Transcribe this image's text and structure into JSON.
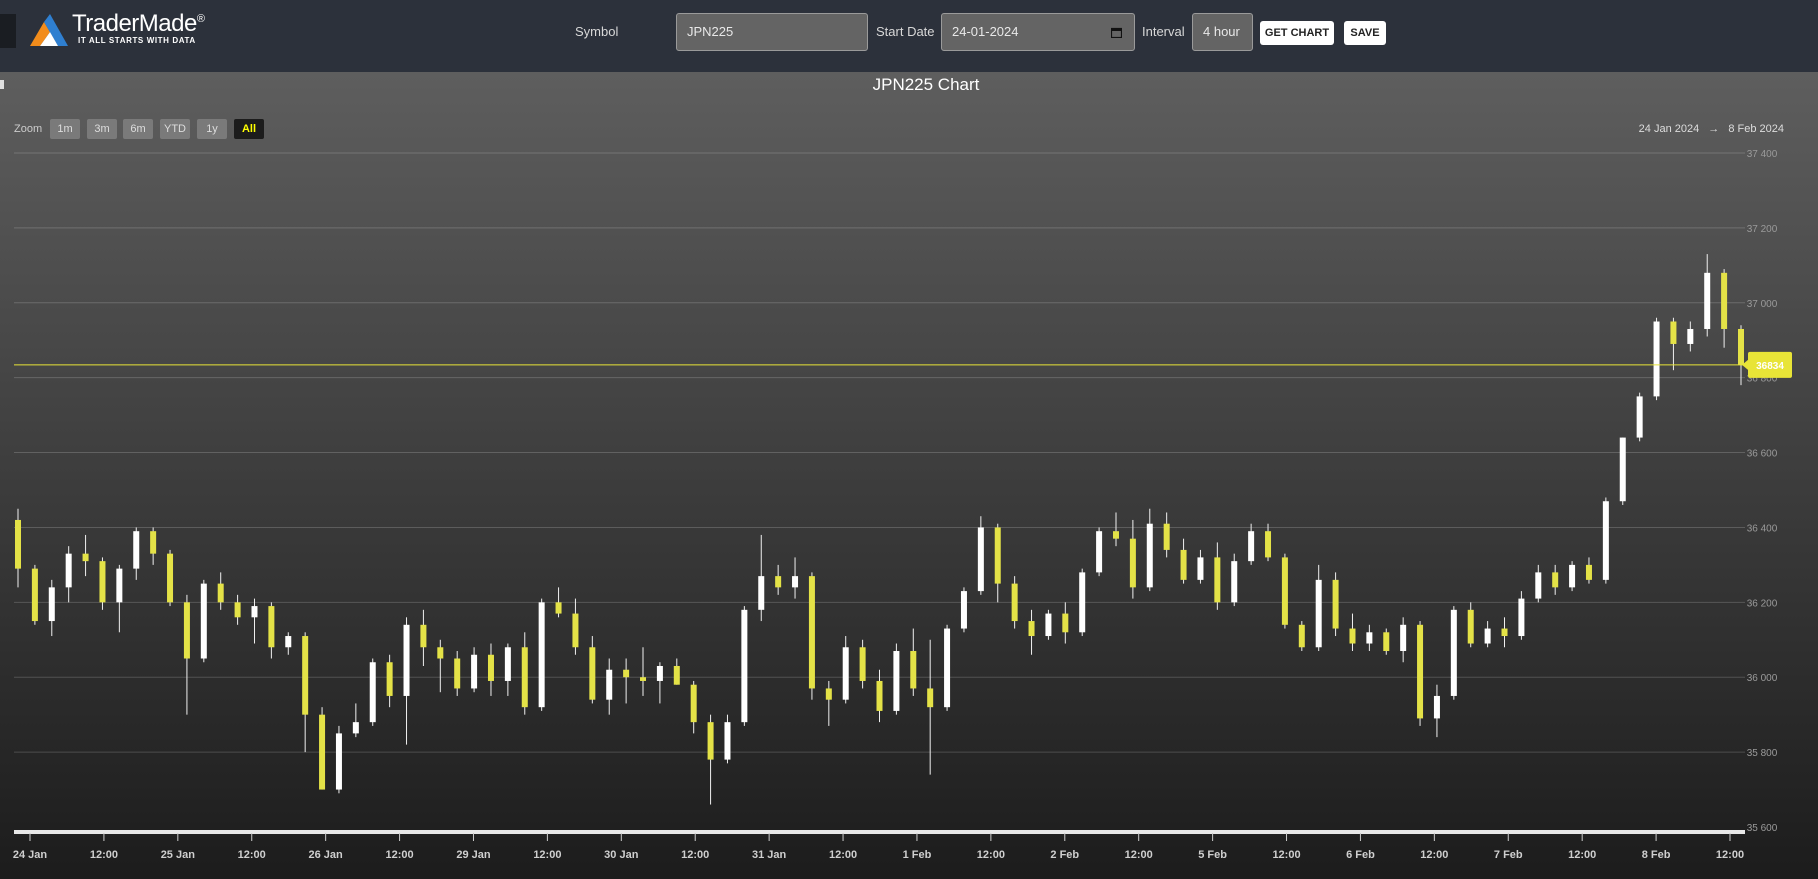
{
  "header": {
    "logo_name": "TraderMade",
    "logo_tagline": "IT ALL STARTS WITH DATA",
    "symbol_label": "Symbol",
    "symbol_value": "JPN225",
    "start_date_label": "Start Date",
    "start_date_value": "24-01-2024",
    "interval_label": "Interval",
    "interval_value": "4 hour",
    "get_chart_label": "GET CHART",
    "save_label": "SAVE"
  },
  "zoom": {
    "label": "Zoom",
    "buttons": [
      "1m",
      "3m",
      "6m",
      "YTD",
      "1y",
      "All"
    ],
    "active": "All"
  },
  "range": {
    "from": "24 Jan 2024",
    "arrow": "→",
    "to": "8 Feb 2024"
  },
  "colors": {
    "up": "#ffffff",
    "down": "#e4e247",
    "last_price": "#e8e437",
    "background_top": "#5e5e5e",
    "background_bottom": "#1c1c1c"
  },
  "chart_data": {
    "type": "candlestick",
    "title": "JPN225 Chart",
    "ylim": [
      35600,
      37400
    ],
    "y_ticks": [
      "35 600",
      "35 800",
      "36 000",
      "36 200",
      "36 400",
      "36 600",
      "36 800",
      "37 000",
      "37 200",
      "37 400"
    ],
    "x_tick_labels": [
      "24 Jan",
      "12:00",
      "25 Jan",
      "12:00",
      "26 Jan",
      "12:00",
      "29 Jan",
      "12:00",
      "30 Jan",
      "12:00",
      "31 Jan",
      "12:00",
      "1 Feb",
      "12:00",
      "2 Feb",
      "12:00",
      "5 Feb",
      "12:00",
      "6 Feb",
      "12:00",
      "7 Feb",
      "12:00",
      "8 Feb",
      "12:00"
    ],
    "last_price": 36834,
    "last_price_label": "36834",
    "candles": [
      [
        36420,
        36450,
        36240,
        36290
      ],
      [
        36290,
        36300,
        36140,
        36150
      ],
      [
        36150,
        36260,
        36110,
        36240
      ],
      [
        36240,
        36350,
        36200,
        36330
      ],
      [
        36330,
        36380,
        36270,
        36310
      ],
      [
        36310,
        36320,
        36180,
        36200
      ],
      [
        36200,
        36300,
        36120,
        36290
      ],
      [
        36290,
        36400,
        36260,
        36390
      ],
      [
        36390,
        36400,
        36300,
        36330
      ],
      [
        36330,
        36340,
        36190,
        36200
      ],
      [
        36200,
        36220,
        35900,
        36050
      ],
      [
        36050,
        36260,
        36040,
        36250
      ],
      [
        36250,
        36280,
        36180,
        36200
      ],
      [
        36200,
        36220,
        36140,
        36160
      ],
      [
        36160,
        36210,
        36090,
        36190
      ],
      [
        36190,
        36200,
        36050,
        36080
      ],
      [
        36080,
        36120,
        36060,
        36110
      ],
      [
        36110,
        36120,
        35800,
        35900
      ],
      [
        35900,
        35920,
        35700,
        35700
      ],
      [
        35700,
        35870,
        35690,
        35850
      ],
      [
        35850,
        35930,
        35840,
        35880
      ],
      [
        35880,
        36050,
        35870,
        36040
      ],
      [
        36040,
        36060,
        35920,
        35950
      ],
      [
        35950,
        36160,
        35820,
        36140
      ],
      [
        36140,
        36180,
        36030,
        36080
      ],
      [
        36080,
        36100,
        35960,
        36050
      ],
      [
        36050,
        36070,
        35950,
        35970
      ],
      [
        35970,
        36080,
        35960,
        36060
      ],
      [
        36060,
        36090,
        35950,
        35990
      ],
      [
        35990,
        36090,
        35950,
        36080
      ],
      [
        36080,
        36120,
        35900,
        35920
      ],
      [
        35920,
        36210,
        35910,
        36200
      ],
      [
        36200,
        36240,
        36160,
        36170
      ],
      [
        36170,
        36210,
        36060,
        36080
      ],
      [
        36080,
        36110,
        35930,
        35940
      ],
      [
        35940,
        36050,
        35900,
        36020
      ],
      [
        36020,
        36050,
        35930,
        36000
      ],
      [
        36000,
        36080,
        35950,
        35990
      ],
      [
        35990,
        36040,
        35930,
        36030
      ],
      [
        36030,
        36050,
        35980,
        35980
      ],
      [
        35980,
        35990,
        35850,
        35880
      ],
      [
        35880,
        35900,
        35660,
        35780
      ],
      [
        35780,
        35900,
        35770,
        35880
      ],
      [
        35880,
        36190,
        35870,
        36180
      ],
      [
        36180,
        36380,
        36150,
        36270
      ],
      [
        36270,
        36300,
        36220,
        36240
      ],
      [
        36240,
        36320,
        36210,
        36270
      ],
      [
        36270,
        36280,
        35940,
        35970
      ],
      [
        35970,
        35990,
        35870,
        35940
      ],
      [
        35940,
        36110,
        35930,
        36080
      ],
      [
        36080,
        36100,
        35970,
        35990
      ],
      [
        35990,
        36020,
        35880,
        35910
      ],
      [
        35910,
        36090,
        35900,
        36070
      ],
      [
        36070,
        36130,
        35950,
        35970
      ],
      [
        35970,
        36100,
        35740,
        35920
      ],
      [
        35920,
        36140,
        35910,
        36130
      ],
      [
        36130,
        36240,
        36120,
        36230
      ],
      [
        36230,
        36430,
        36220,
        36400
      ],
      [
        36400,
        36410,
        36200,
        36250
      ],
      [
        36250,
        36270,
        36130,
        36150
      ],
      [
        36150,
        36180,
        36060,
        36110
      ],
      [
        36110,
        36180,
        36100,
        36170
      ],
      [
        36170,
        36200,
        36090,
        36120
      ],
      [
        36120,
        36290,
        36110,
        36280
      ],
      [
        36280,
        36400,
        36270,
        36390
      ],
      [
        36390,
        36440,
        36350,
        36370
      ],
      [
        36370,
        36420,
        36210,
        36240
      ],
      [
        36240,
        36450,
        36230,
        36410
      ],
      [
        36410,
        36440,
        36320,
        36340
      ],
      [
        36340,
        36370,
        36250,
        36260
      ],
      [
        36260,
        36340,
        36250,
        36320
      ],
      [
        36320,
        36360,
        36180,
        36200
      ],
      [
        36200,
        36330,
        36190,
        36310
      ],
      [
        36310,
        36410,
        36300,
        36390
      ],
      [
        36390,
        36410,
        36310,
        36320
      ],
      [
        36320,
        36330,
        36130,
        36140
      ],
      [
        36140,
        36150,
        36070,
        36080
      ],
      [
        36080,
        36300,
        36070,
        36260
      ],
      [
        36260,
        36280,
        36110,
        36130
      ],
      [
        36130,
        36170,
        36070,
        36090
      ],
      [
        36090,
        36140,
        36070,
        36120
      ],
      [
        36120,
        36130,
        36060,
        36070
      ],
      [
        36070,
        36160,
        36040,
        36140
      ],
      [
        36140,
        36150,
        35870,
        35890
      ],
      [
        35890,
        35980,
        35840,
        35950
      ],
      [
        35950,
        36190,
        35940,
        36180
      ],
      [
        36180,
        36200,
        36080,
        36090
      ],
      [
        36090,
        36150,
        36080,
        36130
      ],
      [
        36130,
        36160,
        36080,
        36110
      ],
      [
        36110,
        36230,
        36100,
        36210
      ],
      [
        36210,
        36300,
        36200,
        36280
      ],
      [
        36280,
        36300,
        36220,
        36240
      ],
      [
        36240,
        36310,
        36230,
        36300
      ],
      [
        36300,
        36320,
        36250,
        36260
      ],
      [
        36260,
        36480,
        36250,
        36470
      ],
      [
        36470,
        36640,
        36460,
        36640
      ],
      [
        36640,
        36760,
        36630,
        36750
      ],
      [
        36750,
        36960,
        36740,
        36950
      ],
      [
        36950,
        36960,
        36820,
        36890
      ],
      [
        36890,
        36950,
        36870,
        36930
      ],
      [
        36930,
        37130,
        36910,
        37080
      ],
      [
        37080,
        37090,
        36880,
        36930
      ],
      [
        36930,
        36940,
        36780,
        36834
      ]
    ]
  }
}
